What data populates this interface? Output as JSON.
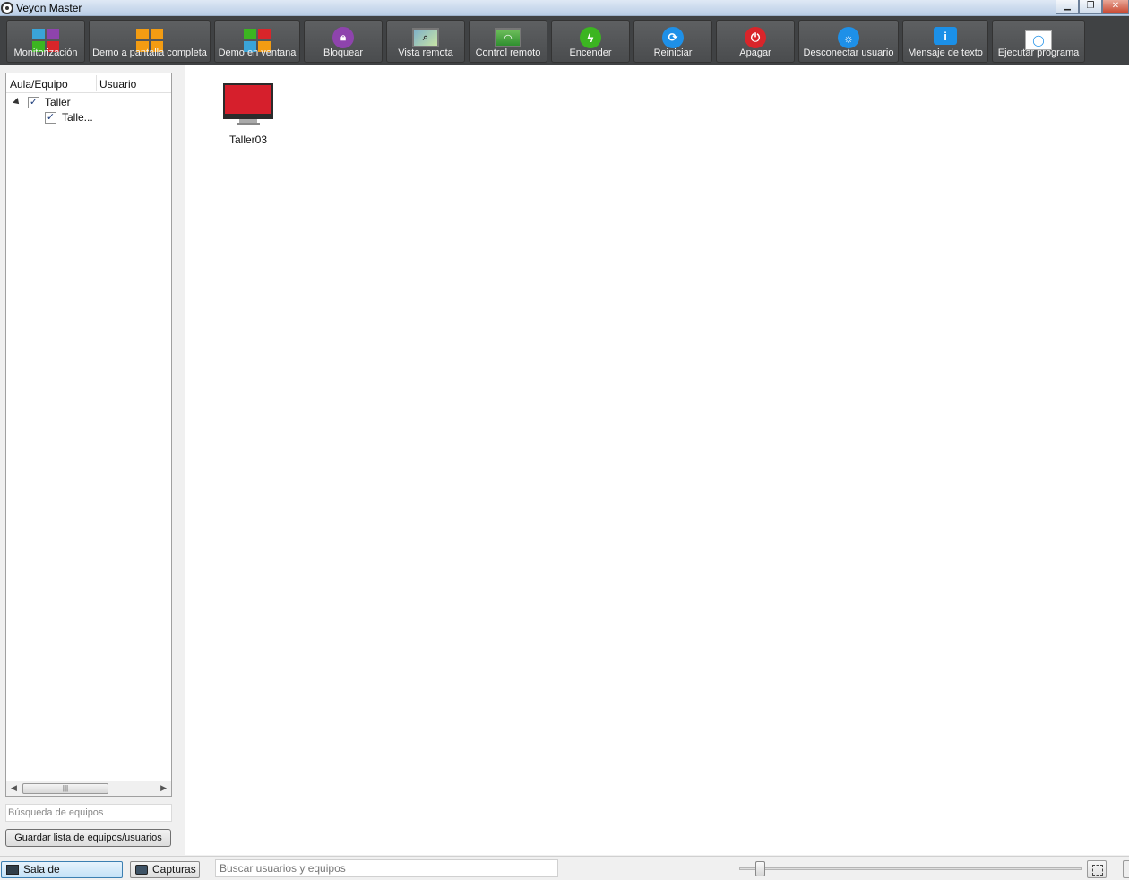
{
  "window": {
    "title": "Veyon Master"
  },
  "toolbar": {
    "buttons": [
      {
        "id": "monitoring",
        "label": "Monitorización",
        "icon": "monitoring-grid-icon"
      },
      {
        "id": "demo-fullscreen",
        "label": "Demo a pantalla completa",
        "icon": "demo-fullscreen-icon"
      },
      {
        "id": "demo-window",
        "label": "Demo en ventana",
        "icon": "demo-window-icon"
      },
      {
        "id": "lock",
        "label": "Bloquear",
        "icon": "lock-icon"
      },
      {
        "id": "remote-view",
        "label": "Vista remota",
        "icon": "remote-view-icon"
      },
      {
        "id": "remote-control",
        "label": "Control remoto",
        "icon": "remote-control-icon"
      },
      {
        "id": "power-on",
        "label": "Encender",
        "icon": "power-on-icon"
      },
      {
        "id": "reboot",
        "label": "Reiniciar",
        "icon": "reboot-icon"
      },
      {
        "id": "power-down",
        "label": "Apagar",
        "icon": "power-off-icon"
      },
      {
        "id": "logout",
        "label": "Desconectar usuario",
        "icon": "logout-user-icon"
      },
      {
        "id": "text-message",
        "label": "Mensaje de texto",
        "icon": "text-message-icon"
      },
      {
        "id": "run-program",
        "label": "Ejecutar programa",
        "icon": "run-program-icon"
      }
    ]
  },
  "colors": {
    "toolbar_bg": "#404244",
    "lock": "#8e44ad",
    "power_on": "#3cb521",
    "reboot": "#1e90e8",
    "power_off": "#d9252a",
    "logout": "#1e90e8",
    "computer_screen": "#d61f2c"
  },
  "tree": {
    "columns": [
      "Aula/Equipo",
      "Usuario"
    ],
    "items": [
      {
        "label": "Taller",
        "checked": true,
        "expanded": true
      },
      {
        "label": "Talle...",
        "checked": true
      }
    ]
  },
  "left_panel": {
    "search_placeholder": "Búsqueda de equipos",
    "save_button": "Guardar lista de equipos/usuarios"
  },
  "computers": [
    {
      "name": "Taller03",
      "status": "red"
    }
  ],
  "statusbar": {
    "tab_rooms": "Sala de ordenadores",
    "tab_screenshots": "Capturas",
    "search_placeholder": "Buscar usuarios y equipos"
  }
}
